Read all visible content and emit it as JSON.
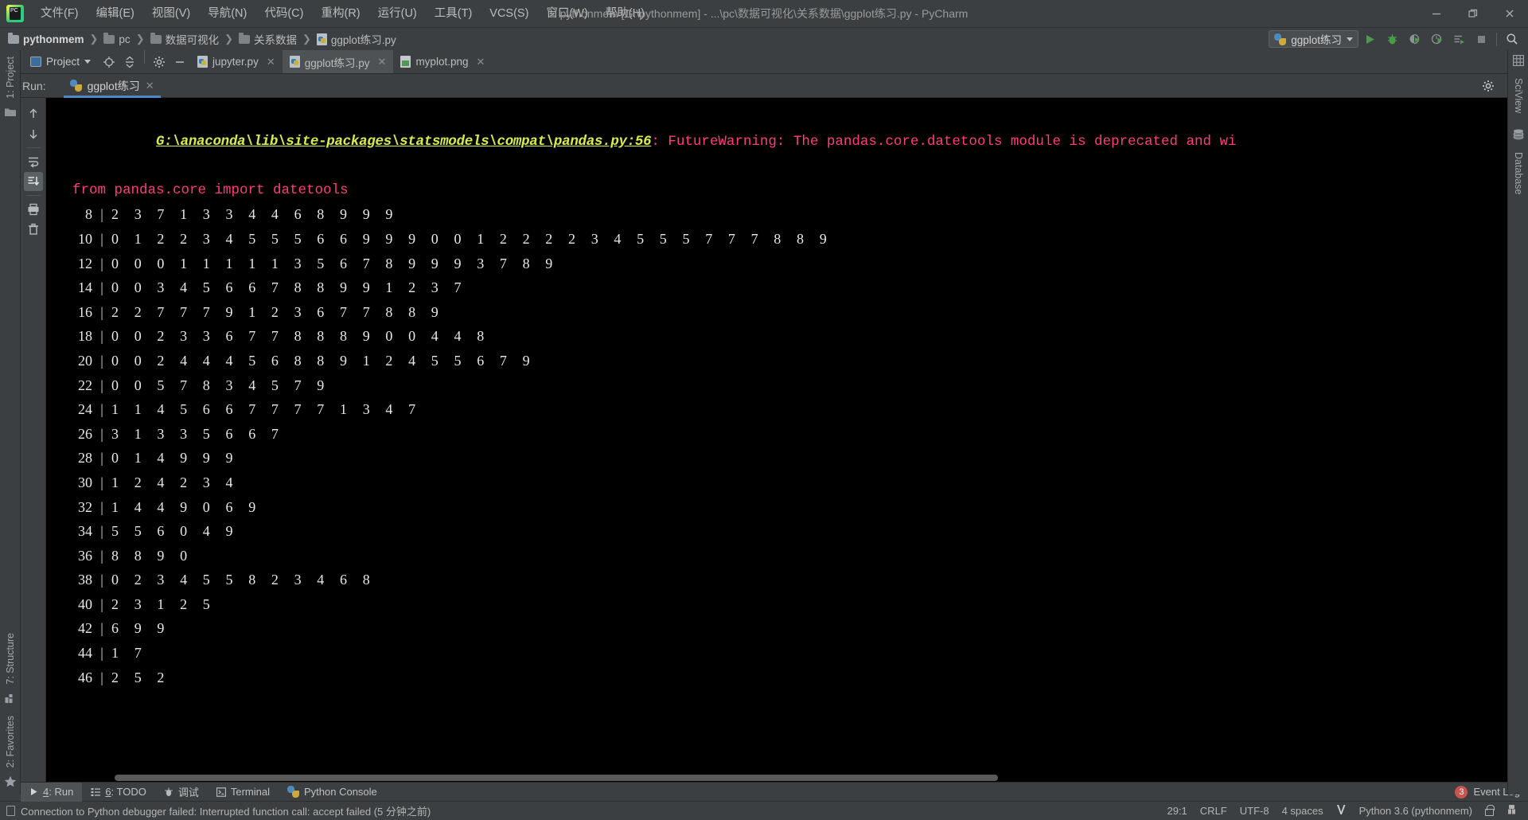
{
  "window": {
    "title": "pythonmem [G:\\pythonmem] - ...\\pc\\数据可视化\\关系数据\\ggplot练习.py - PyCharm",
    "minimize": "—",
    "maximize": "❐",
    "close": "✕"
  },
  "menubar": {
    "items": [
      {
        "label": "文件(F)"
      },
      {
        "label": "编辑(E)"
      },
      {
        "label": "视图(V)"
      },
      {
        "label": "导航(N)"
      },
      {
        "label": "代码(C)"
      },
      {
        "label": "重构(R)"
      },
      {
        "label": "运行(U)"
      },
      {
        "label": "工具(T)"
      },
      {
        "label": "VCS(S)"
      },
      {
        "label": "窗口(W)"
      },
      {
        "label": "帮助(H)"
      }
    ]
  },
  "breadcrumb": {
    "items": [
      {
        "label": "pythonmem",
        "icon": "folder-icon"
      },
      {
        "label": "pc",
        "icon": "folder-icon"
      },
      {
        "label": "数据可视化",
        "icon": "folder-icon"
      },
      {
        "label": "关系数据",
        "icon": "folder-icon"
      },
      {
        "label": "ggplot练习.py",
        "icon": "python-file-icon"
      }
    ],
    "separator": "❯"
  },
  "run_config": {
    "name": "ggplot练习",
    "toolbar_icons": [
      "run-icon",
      "debug-icon",
      "coverage-icon",
      "profile-icon",
      "run-with-params-icon",
      "stop-icon",
      "search-icon"
    ]
  },
  "project_tab": {
    "label": "Project"
  },
  "editor_tabs": [
    {
      "label": "jupyter.py",
      "icon": "python-file-icon",
      "active": false,
      "close": "✕"
    },
    {
      "label": "ggplot练习.py",
      "icon": "python-file-icon",
      "active": true,
      "close": "✕"
    },
    {
      "label": "myplot.png",
      "icon": "image-file-icon",
      "active": false,
      "close": "✕"
    }
  ],
  "run_window": {
    "label": "Run:",
    "tab_name": "ggplot练习",
    "tab_close": "✕",
    "gutter_left": [
      "rerun-icon",
      "stop-icon",
      "layout-icon",
      "pin-icon"
    ],
    "gutter_right": [
      "up-arrow-icon",
      "down-arrow-icon",
      "soft-wrap-icon",
      "scroll-to-end-icon",
      "print-icon",
      "trash-icon"
    ],
    "header_right": [
      "settings-gear-icon",
      "hide-icon"
    ]
  },
  "console": {
    "warning_path": "G:\\anaconda\\lib\\site-packages\\statsmodels\\compat\\pandas.py:56",
    "warning_sep": ": ",
    "warning_message": "FutureWarning: The pandas.core.datetools module is deprecated and wi",
    "import_line": "  from pandas.core import datetools",
    "stem_separator": "|",
    "stem_leaf_rows": [
      {
        "stem": "8",
        "leaves": "2 3 7 1 3 3 4 4 6 8 9 9 9"
      },
      {
        "stem": "10",
        "leaves": "0 1 2 2 3 4 5 5 5 6 6 9 9 9 0 0 1 2 2 2 2 3 4 5 5 5 7 7 7 8 8 9"
      },
      {
        "stem": "12",
        "leaves": "0 0 0 1 1 1 1 1 3 5 6 7 8 9 9 9 3 7 8 9"
      },
      {
        "stem": "14",
        "leaves": "0 0 3 4 5 6 6 7 8 8 9 9 1 2 3 7"
      },
      {
        "stem": "16",
        "leaves": "2 2 7 7 7 9 1 2 3 6 7 7 8 8 9"
      },
      {
        "stem": "18",
        "leaves": "0 0 2 3 3 6 7 7 8 8 8 9 0 0 4 4 8"
      },
      {
        "stem": "20",
        "leaves": "0 0 2 4 4 4 5 6 8 8 9 1 2 4 5 5 6 7 9"
      },
      {
        "stem": "22",
        "leaves": "0 0 5 7 8 3 4 5 7 9"
      },
      {
        "stem": "24",
        "leaves": "1 1 4 5 6 6 7 7 7 7 1 3 4 7"
      },
      {
        "stem": "26",
        "leaves": "3 1 3 3 5 6 6 7"
      },
      {
        "stem": "28",
        "leaves": "0 1 4 9 9 9"
      },
      {
        "stem": "30",
        "leaves": "1 2 4 2 3 4"
      },
      {
        "stem": "32",
        "leaves": "1 4 4 9 0 6 9"
      },
      {
        "stem": "34",
        "leaves": "5 5 6 0 4 9"
      },
      {
        "stem": "36",
        "leaves": "8 8 9 0"
      },
      {
        "stem": "38",
        "leaves": "0 2 3 4 5 5 8 2 3 4 6 8"
      },
      {
        "stem": "40",
        "leaves": "2 3 1 2 5"
      },
      {
        "stem": "42",
        "leaves": "6 9 9"
      },
      {
        "stem": "44",
        "leaves": "1 7"
      },
      {
        "stem": "46",
        "leaves": "2 5 2"
      }
    ]
  },
  "left_stripe": {
    "items": [
      {
        "label": "1: Project",
        "icon": "project-folder-icon"
      },
      {
        "label": "7: Structure",
        "icon": "structure-icon"
      },
      {
        "label": "2: Favorites",
        "icon": "star-icon"
      }
    ]
  },
  "right_stripe": {
    "items": [
      {
        "label": "SciView",
        "icon": "grid-icon"
      },
      {
        "label": "Database",
        "icon": "database-icon"
      }
    ]
  },
  "bottom_windows": [
    {
      "num": "4",
      "label": ": Run",
      "icon": "run-triangle-icon",
      "active": true
    },
    {
      "num": "6",
      "label": ": TODO",
      "icon": "todo-list-icon",
      "active": false
    },
    {
      "num": "",
      "label": "调试",
      "icon": "debug-bug-icon",
      "active": false
    },
    {
      "num": "",
      "label": "Terminal",
      "icon": "terminal-icon",
      "active": false
    },
    {
      "num": "",
      "label": "Python Console",
      "icon": "python-console-icon",
      "active": false
    }
  ],
  "event_log": {
    "label": "Event Log",
    "count": "3"
  },
  "status_bar": {
    "message": "Connection to Python debugger failed: Interrupted function call: accept failed (5 分钟之前)",
    "caret": "29:1",
    "line_sep": "CRLF",
    "encoding": "UTF-8",
    "indent": "4 spaces",
    "branch_icon": "branch-icon",
    "interpreter": "Python 3.6 (pythonmem)",
    "lock_icon": "lock-icon",
    "inspection_icon": "inspection-icon"
  },
  "colors": {
    "accent": "#4a88c7",
    "warn_path": "#d7ec4b",
    "warn_text": "#ff3b7b",
    "console_bg": "#000000",
    "chrome_bg": "#3c3f41",
    "badge_red": "#c75450"
  }
}
